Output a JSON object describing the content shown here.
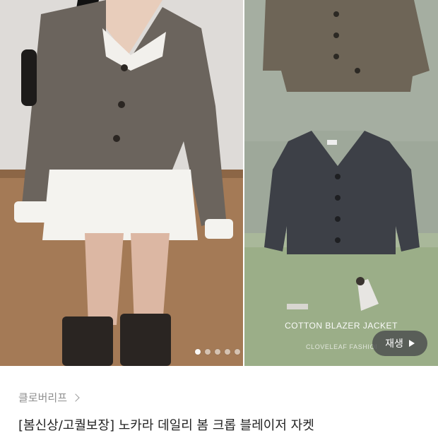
{
  "hero": {
    "overlay_title": "COTTON BLAZER JACKET",
    "overlay_brand": "CLOVELEAF FASHION",
    "play_label": "재생",
    "slide_dots": {
      "count": 5,
      "active_index": 0
    }
  },
  "product": {
    "brand": "클로버리프",
    "title": "[봄신상/고퀄보장] 노카라 데일리 봄 크롭 블레이저 자켓"
  }
}
